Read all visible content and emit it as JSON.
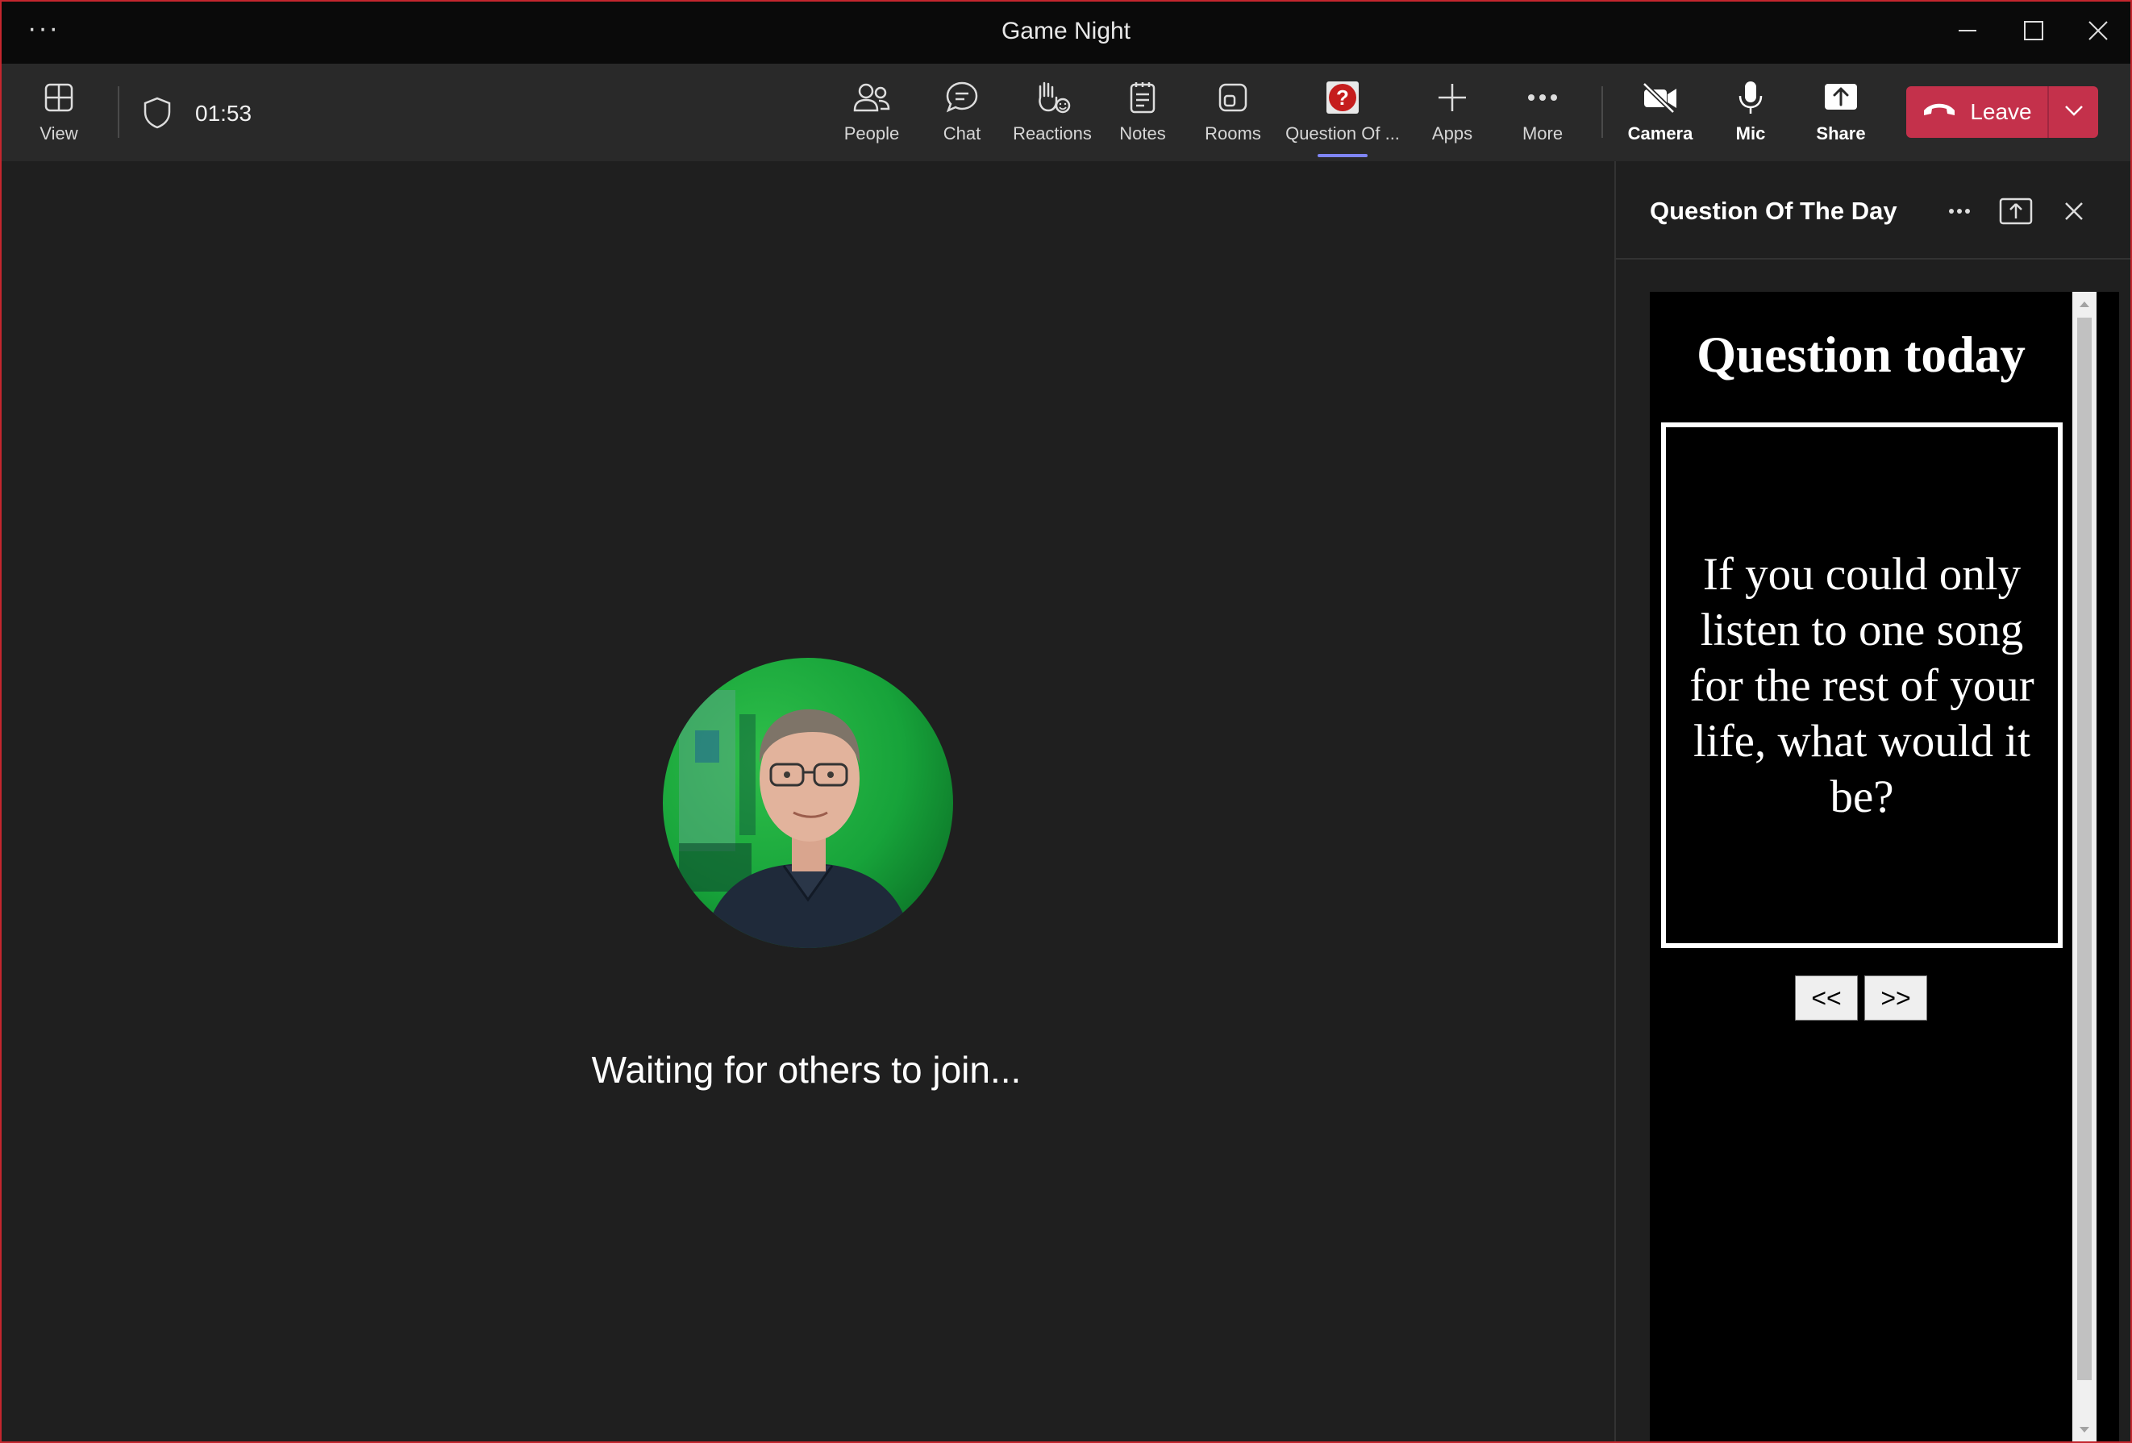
{
  "window": {
    "title": "Game Night"
  },
  "toolbar": {
    "view_label": "View",
    "timer": "01:53",
    "buttons": {
      "people": "People",
      "chat": "Chat",
      "reactions": "Reactions",
      "notes": "Notes",
      "rooms": "Rooms",
      "question": "Question Of ...",
      "apps": "Apps",
      "more": "More",
      "camera": "Camera",
      "mic": "Mic",
      "share": "Share"
    },
    "leave_label": "Leave",
    "leave_color": "#c4314b",
    "active_indicator_color": "#7f85f5"
  },
  "stage": {
    "waiting_text": "Waiting for others to join..."
  },
  "panel": {
    "title": "Question Of The Day",
    "app": {
      "heading": "Question today",
      "question": "If you could only listen to one song for the rest of your life, what would it be?",
      "prev_label": "<<",
      "next_label": ">>"
    }
  }
}
